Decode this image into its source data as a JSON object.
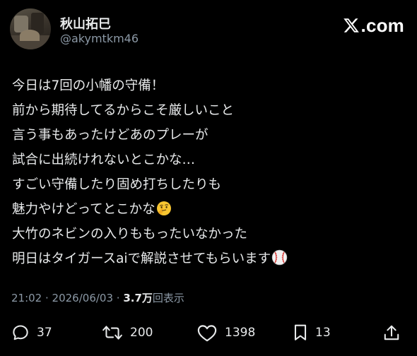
{
  "user": {
    "name": "秋山拓巳",
    "handle": "@akymtkm46"
  },
  "brand": {
    "text": ".com"
  },
  "tweet": {
    "lines": [
      "今日は7回の小幡の守備！",
      "前から期待してるからこそ厳しいこと",
      "言う事もあったけどあのプレーが",
      "試合に出続けれないとこかな…",
      "すごい守備したり固め打ちしたりも",
      "魅力やけどってとこかな",
      "大竹のネビンの入りももったいなかった",
      "明日はタイガースaiで解説させてもらいます"
    ],
    "emojis": {
      "line6": "thinking-face-emoji",
      "line8": "baseball-emoji"
    }
  },
  "meta": {
    "time": "21:02",
    "separator1": " · ",
    "date": "2026/06/03",
    "separator2": " · ",
    "views_count": "3.7万",
    "views_label": "回表示"
  },
  "actions": {
    "replies": "37",
    "reposts": "200",
    "likes": "1398",
    "bookmarks": "13"
  },
  "colors": {
    "background": "#000000",
    "text": "#e7e9ea",
    "secondary": "#8b98a5"
  }
}
